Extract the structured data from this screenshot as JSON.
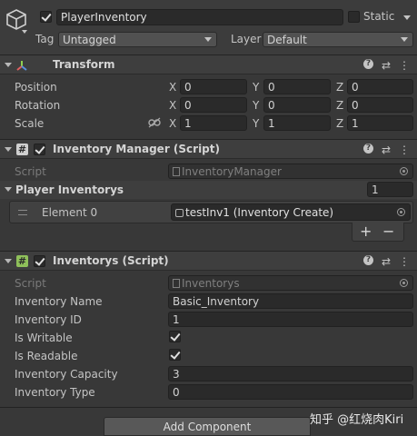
{
  "object": {
    "name": "PlayerInventory",
    "static_label": "Static",
    "tag_label": "Tag",
    "tag_value": "Untagged",
    "layer_label": "Layer",
    "layer_value": "Default"
  },
  "transform": {
    "title": "Transform",
    "rows": [
      {
        "label": "Position",
        "x": "0",
        "y": "0",
        "z": "0"
      },
      {
        "label": "Rotation",
        "x": "0",
        "y": "0",
        "z": "0"
      },
      {
        "label": "Scale",
        "x": "1",
        "y": "1",
        "z": "1"
      }
    ],
    "axis": {
      "x": "X",
      "y": "Y",
      "z": "Z"
    }
  },
  "inventory_manager": {
    "title": "Inventory Manager (Script)",
    "script_label": "Script",
    "script_value": "InventoryManager",
    "list_label": "Player Inventorys",
    "list_count": "1",
    "element_label": "Element 0",
    "element_value": "testInv1 (Inventory Create)",
    "add": "+",
    "remove": "−"
  },
  "inventorys": {
    "title": "Inventorys (Script)",
    "script_label": "Script",
    "script_value": "Inventorys",
    "fields": {
      "name_label": "Inventory Name",
      "name_value": "Basic_Inventory",
      "id_label": "Inventory ID",
      "id_value": "1",
      "writable_label": "Is Writable",
      "readable_label": "Is Readable",
      "capacity_label": "Inventory Capacity",
      "capacity_value": "3",
      "type_label": "Inventory Type",
      "type_value": "0"
    }
  },
  "footer": {
    "add_component": "Add Component",
    "watermark": "知乎 @红烧肉Kiri"
  },
  "header_icons": {
    "help": "?",
    "presets": "⇄",
    "more": "⋮"
  }
}
